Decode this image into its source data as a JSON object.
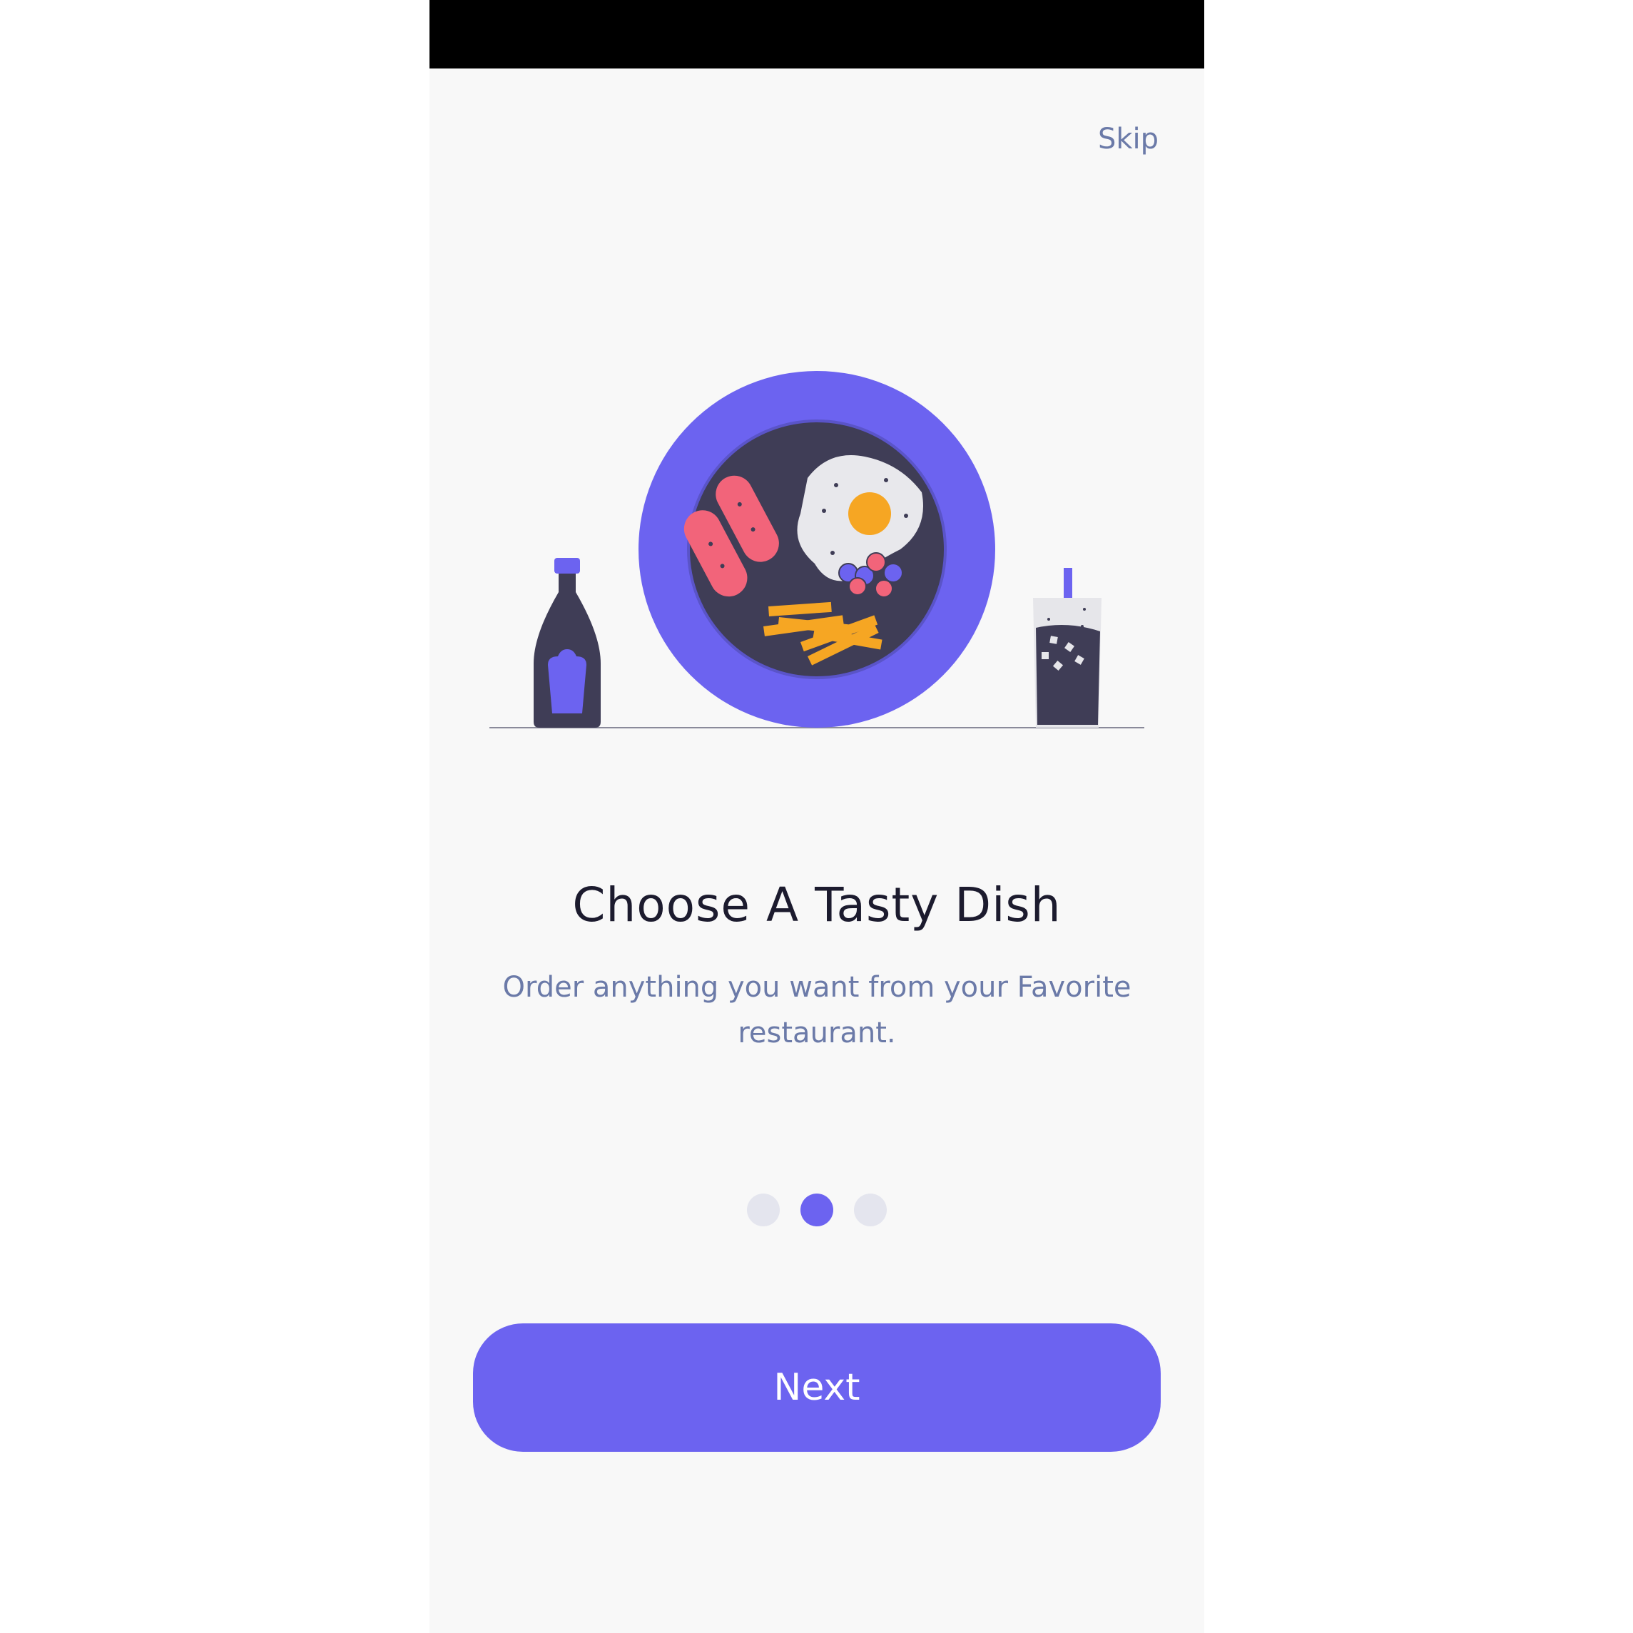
{
  "header": {
    "skip_label": "Skip"
  },
  "onboarding": {
    "title": "Choose A Tasty Dish",
    "subtitle": "Order anything you want from your Favorite restaurant.",
    "page_indicator": {
      "total": 3,
      "current": 2
    },
    "next_label": "Next"
  },
  "illustration": {
    "icon": "food-plate-illustration",
    "items": [
      "ketchup-bottle-icon",
      "plate-icon",
      "drink-glass-icon"
    ]
  },
  "colors": {
    "accent": "#6c63f0",
    "dark": "#3f3d56",
    "background": "#f8f8f8",
    "muted_text": "#6b7aa8",
    "title_text": "#1c1b2e",
    "dot_inactive": "#e4e5ee"
  }
}
